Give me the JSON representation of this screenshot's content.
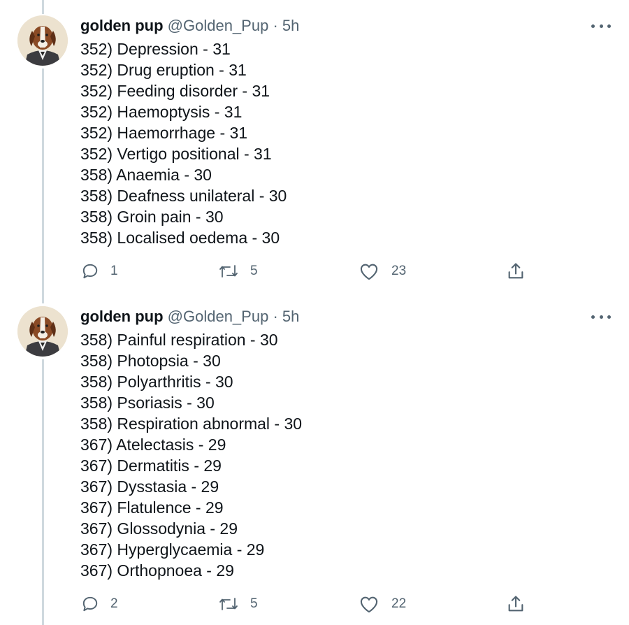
{
  "tweets": [
    {
      "name": "golden pup",
      "handle": "@Golden_Pup",
      "sep": "·",
      "time": "5h",
      "lines": [
        "352) Depression - 31",
        "352) Drug eruption - 31",
        "352) Feeding disorder - 31",
        "352) Haemoptysis - 31",
        "352) Haemorrhage - 31",
        "352) Vertigo positional - 31",
        "358) Anaemia - 30",
        "358) Deafness unilateral - 30",
        "358) Groin pain - 30",
        "358) Localised oedema - 30"
      ],
      "replies": "1",
      "retweets": "5",
      "likes": "23"
    },
    {
      "name": "golden pup",
      "handle": "@Golden_Pup",
      "sep": "·",
      "time": "5h",
      "lines": [
        "358) Painful respiration - 30",
        "358) Photopsia - 30",
        "358) Polyarthritis - 30",
        "358) Psoriasis - 30",
        "358) Respiration abnormal - 30",
        "367) Atelectasis - 29",
        "367) Dermatitis - 29",
        "367) Dysstasia - 29",
        "367) Flatulence - 29",
        "367) Glossodynia - 29",
        "367) Hyperglycaemia - 29",
        "367) Orthopnoea - 29"
      ],
      "replies": "2",
      "retweets": "5",
      "likes": "22"
    }
  ],
  "icons": {
    "reply": "reply-icon",
    "retweet": "retweet-icon",
    "like": "like-icon",
    "share": "share-icon",
    "more": "more-icon"
  },
  "colors": {
    "text": "#0f1419",
    "secondary": "#536471",
    "thread_line": "#cfd9de"
  }
}
